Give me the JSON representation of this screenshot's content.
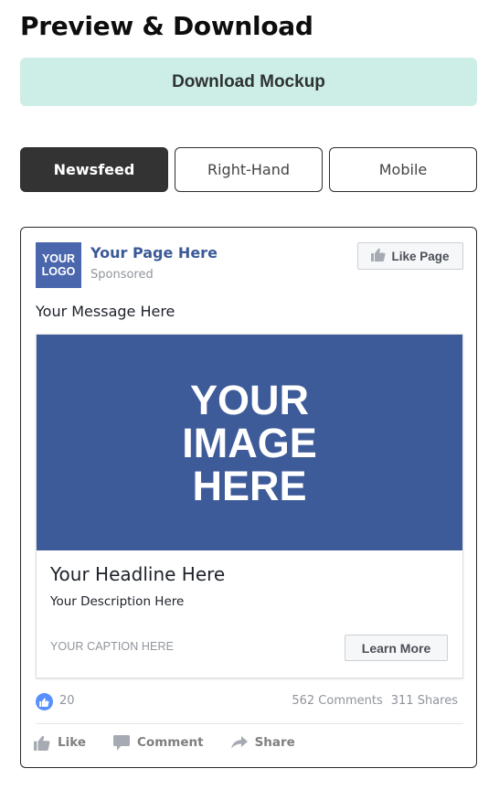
{
  "header": {
    "title": "Preview & Download",
    "download_label": "Download Mockup"
  },
  "tabs": [
    {
      "label": "Newsfeed",
      "active": true
    },
    {
      "label": "Right-Hand",
      "active": false
    },
    {
      "label": "Mobile",
      "active": false
    }
  ],
  "post": {
    "logo_line1": "YOUR",
    "logo_line2": "LOGO",
    "page_name": "Your Page Here",
    "sponsored": "Sponsored",
    "like_page_label": "Like Page",
    "message": "Your Message Here",
    "image_line1": "YOUR",
    "image_line2": "IMAGE",
    "image_line3": "HERE",
    "headline": "Your Headline Here",
    "description": "Your Description Here",
    "caption": "YOUR CAPTION HERE",
    "cta_label": "Learn More",
    "like_count": "20",
    "comments": "562 Comments",
    "shares": "311 Shares",
    "actions": {
      "like": "Like",
      "comment": "Comment",
      "share": "Share"
    }
  },
  "colors": {
    "brand_blue": "#3b5998",
    "image_blue": "#3e5b99",
    "download_bg": "#cdeee6",
    "active_tab_bg": "#333333",
    "like_bubble": "#5890ff"
  },
  "icons": {
    "like_page": "thumbs-up-icon",
    "reaction": "like-reaction-icon",
    "like_action": "thumbs-up-icon",
    "comment_action": "comment-bubble-icon",
    "share_action": "share-arrow-icon"
  }
}
